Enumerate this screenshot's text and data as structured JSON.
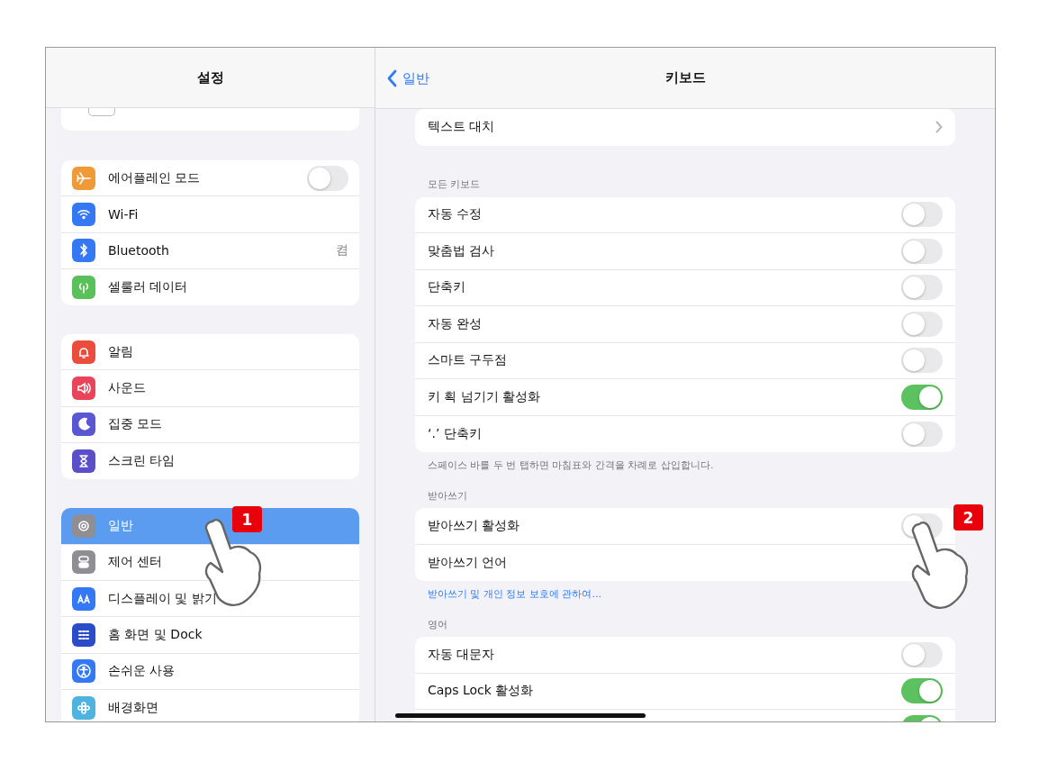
{
  "sidebar": {
    "title": "설정",
    "groups": [
      {
        "items": [
          {
            "label": "에어플레인 모드",
            "color": "#f09a37",
            "kind": "toggle",
            "on": false,
            "selected": false
          },
          {
            "label": "Wi-Fi",
            "color": "#3478f6",
            "kind": "plain",
            "selected": false
          },
          {
            "label": "Bluetooth",
            "color": "#3478f6",
            "kind": "value",
            "value": "켬",
            "selected": false
          },
          {
            "label": "셀룰러 데이터",
            "color": "#5ac05a",
            "kind": "plain",
            "selected": false
          }
        ]
      },
      {
        "items": [
          {
            "label": "알림",
            "color": "#eb4d3d",
            "kind": "plain",
            "selected": false
          },
          {
            "label": "사운드",
            "color": "#e9445a",
            "kind": "plain",
            "selected": false
          },
          {
            "label": "집중 모드",
            "color": "#5b56d3",
            "kind": "plain",
            "selected": false
          },
          {
            "label": "스크린 타임",
            "color": "#5b4fc9",
            "kind": "plain",
            "selected": false
          }
        ]
      },
      {
        "items": [
          {
            "label": "일반",
            "color": "#8e8e93",
            "kind": "plain",
            "selected": true
          },
          {
            "label": "제어 센터",
            "color": "#8e8e93",
            "kind": "plain",
            "selected": false
          },
          {
            "label": "디스플레이 및 밝기",
            "color": "#3478f6",
            "kind": "plain",
            "selected": false
          },
          {
            "label": "홈 화면 및 Dock",
            "color": "#2a4cc9",
            "kind": "plain",
            "selected": false
          },
          {
            "label": "손쉬운 사용",
            "color": "#3478f6",
            "kind": "plain",
            "selected": false
          },
          {
            "label": "배경화면",
            "color": "#4fb3e0",
            "kind": "plain",
            "selected": false
          }
        ]
      }
    ]
  },
  "detail": {
    "back": "일반",
    "title": "키보드",
    "sections": [
      {
        "rows": [
          {
            "label": "텍스트 대치",
            "kind": "chevron"
          }
        ]
      },
      {
        "header": "모든 키보드",
        "footer": "스페이스 바를 두 번 탭하면 마침표와 간격을 차례로 삽입합니다.",
        "rows": [
          {
            "label": "자동 수정",
            "kind": "toggle",
            "on": false
          },
          {
            "label": "맞춤법 검사",
            "kind": "toggle",
            "on": false
          },
          {
            "label": "단축키",
            "kind": "toggle",
            "on": false
          },
          {
            "label": "자동 완성",
            "kind": "toggle",
            "on": false
          },
          {
            "label": "스마트 구두점",
            "kind": "toggle",
            "on": false
          },
          {
            "label": "키 획 넘기기 활성화",
            "kind": "toggle",
            "on": true
          },
          {
            "label": "‘.’ 단축키",
            "kind": "toggle",
            "on": false
          }
        ]
      },
      {
        "header": "받아쓰기",
        "link": "받아쓰기 및 개인 정보 보호에 관하여...",
        "rows": [
          {
            "label": "받아쓰기 활성화",
            "kind": "toggle",
            "on": false
          },
          {
            "label": "받아쓰기 언어",
            "kind": "plain"
          }
        ]
      },
      {
        "header": "영어",
        "rows": [
          {
            "label": "자동 대문자",
            "kind": "toggle",
            "on": false
          },
          {
            "label": "Caps Lock 활성화",
            "kind": "toggle",
            "on": true
          },
          {
            "kind": "toggle",
            "on": true
          }
        ]
      }
    ]
  },
  "markers": [
    {
      "number": "1"
    },
    {
      "number": "2"
    }
  ]
}
